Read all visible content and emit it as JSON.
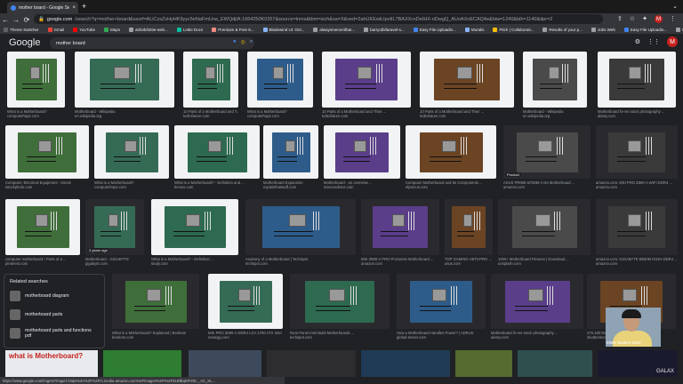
{
  "browser": {
    "tab_title": "mother board - Google Search",
    "tab_close": "×",
    "new_tab": "+",
    "tab_menu": "⌄",
    "nav": {
      "back": "←",
      "forward": "→",
      "reload": "⟳"
    },
    "url_host": "google.com",
    "url_path": "/search?q=mother+board&sxsrf=ALiCzsZvHyHK9yyc5eNaFmUna_EWQdjIA:1664250K0357&source=lnms&tbm=isch&sa=X&ved=2ahUKEwiLtpvtIL7BAXXcxDeIHX-nDwgQ_AUoAXoECAQ4e&biw=1240&bih=1140&dpr=2",
    "bookmarks": [
      {
        "label": "Theme Switcher",
        "color": "#5f6368"
      },
      {
        "label": "Gmail",
        "color": "#ea4335"
      },
      {
        "label": "YouTube",
        "color": "#ff0000"
      },
      {
        "label": "Maps",
        "color": "#34a853"
      },
      {
        "label": "airbnb/lottie-web...",
        "color": "#9aa0a6"
      },
      {
        "label": "Lottie Docs",
        "color": "#00c1a2"
      },
      {
        "label": "Premium & Free 8...",
        "color": "#f28b82"
      },
      {
        "label": "Bladewind UI: Onl...",
        "color": "#8ab4f8"
      },
      {
        "label": "alwaysmecent/bar...",
        "color": "#9aa0a6"
      },
      {
        "label": "barryotb/laravel-s...",
        "color": "#9aa0a6"
      },
      {
        "label": "Easy File Uploadin...",
        "color": "#4285f4"
      },
      {
        "label": "Moralis",
        "color": "#8ab4f8"
      },
      {
        "label": "Pitch | Collaborati...",
        "color": "#fbbc04"
      },
      {
        "label": "Results of your p...",
        "color": "#9aa0a6"
      },
      {
        "label": "Jobs Web",
        "color": "#9aa0a6"
      },
      {
        "label": "Easy File Uploadin...",
        "color": "#4285f4"
      },
      {
        "label": "New Tab",
        "color": "#9aa0a6"
      }
    ]
  },
  "google": {
    "logo": "Google",
    "query": "mother board",
    "account_initial": "M"
  },
  "results": [
    {
      "title": "What is a Motherboard?",
      "source": "computerhope.com"
    },
    {
      "title": "Motherboard - Wikipedia",
      "source": "en.wikipedia.org"
    },
    {
      "title": "10 Parts of a Motherboard and T...",
      "source": "turbofuture.com"
    },
    {
      "title": "What is a Motherboard?",
      "source": "computerhope.com"
    },
    {
      "title": "10 Parts of a Motherboard and Their ...",
      "source": "turbofuture.com"
    },
    {
      "title": "10 Parts of a Motherboard and Their ...",
      "source": "turbofuture.com"
    },
    {
      "title": "Motherboard - Wikipedia",
      "source": "en.wikipedia.org"
    },
    {
      "title": "Motherboard hi-res stock photography ...",
      "source": "alamy.com"
    },
    {
      "title": "Computer, Electrical Equipment - iStock",
      "source": "istockphoto.com"
    },
    {
      "title": "What is a Motherboard?",
      "source": "computerhope.com"
    },
    {
      "title": "What is a Motherboard? - Definition and ...",
      "source": "lenovo.com"
    },
    {
      "title": "Motherboard Expansion",
      "source": "explainthatstuff.com"
    },
    {
      "title": "Motherboard - an overview ...",
      "source": "sciencedirect.com"
    },
    {
      "title": "Computer Motherboard and Its Components ...",
      "source": "elprocus.com"
    },
    {
      "title": "ASUS PRIME B760M-A D4 Motherboard ...",
      "source": "amazon.com"
    },
    {
      "title": "amazon.com: MSI PRO Z690-A WIFI DDR4 ...",
      "source": "amazon.com"
    },
    {
      "title": "computer motherboard / Parts of a ...",
      "source": "pinterest.com"
    },
    {
      "title": "Motherboard - GIGABYTE",
      "source": "gigabyte.com"
    },
    {
      "title": "What is a Motherboard? - Definition ...",
      "source": "study.com"
    },
    {
      "title": "Anatomy of a Motherboard | TechSpot",
      "source": "techspot.com"
    },
    {
      "title": "MSI Z690-A PRO ProSeries Motherboard ...",
      "source": "amazon.com"
    },
    {
      "title": "TOP GAMING H670-PRO ...",
      "source": "asus.com"
    },
    {
      "title": "1000+ Motherboard Pictures | Download ...",
      "source": "unsplash.com"
    },
    {
      "title": "amazon.com: GIGABYTE B550M DS3H DDR4 ...",
      "source": "amazon.com"
    },
    {
      "title": "What is a Motherboard? Explained | Beebom",
      "source": "beebom.com"
    },
    {
      "title": "MSI PRO Z690-A DDR4 LGA 1700 ATX Intel ...",
      "source": "newegg.com"
    },
    {
      "title": "Rear Panel Intel Build Motherboards ...",
      "source": "techspot.com"
    },
    {
      "title": "How a Motherboard Handles Power? | ADRUS",
      "source": "global-server.com"
    },
    {
      "title": "Motherboard hi-res stock photography ...",
      "source": "alamy.com"
    },
    {
      "title": "270,183 Motherboard Images, Stock ...",
      "source": "shutterstock.com"
    }
  ],
  "badges": {
    "product": "Product",
    "in_stock": "In stock",
    "duration": "3 years ago"
  },
  "related": {
    "title": "Related searches",
    "items": [
      "motherboard diagram",
      "motherboard parts",
      "motherboard parts and functions pdf"
    ]
  },
  "bottom_caption": "what is Motherboard?",
  "webcam_label": "MMS Student 2023",
  "watermark": "GALAX",
  "status_url": "https://www.google.com/imgres?imgurl=https%3A%2F%2Fm.media-amazon.com%2Fimages%2FI%2F61BfBqWFZ8L._AC_SL..."
}
